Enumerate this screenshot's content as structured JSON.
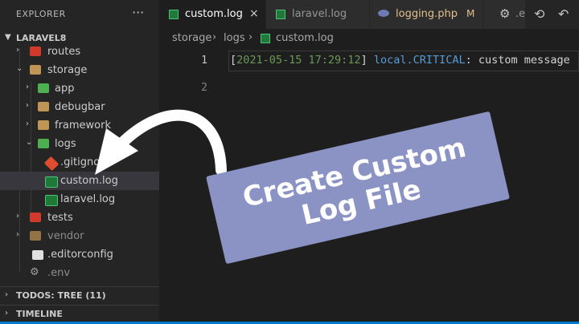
{
  "sidebar": {
    "title": "EXPLORER",
    "more": "···",
    "project": "LARAVEL8",
    "tree": [
      {
        "label": "routes",
        "icon": "folder-red-icon"
      },
      {
        "label": "storage",
        "icon": "folder-open-icon"
      },
      {
        "label": "app",
        "icon": "folder-green-icon"
      },
      {
        "label": "debugbar",
        "icon": "folder-icon"
      },
      {
        "label": "framework",
        "icon": "folder-icon"
      },
      {
        "label": "logs",
        "icon": "folder-open-green-icon"
      },
      {
        "label": ".gitignore",
        "icon": "git-icon"
      },
      {
        "label": "custom.log",
        "icon": "log-file-icon"
      },
      {
        "label": "laravel.log",
        "icon": "log-file-icon"
      },
      {
        "label": "tests",
        "icon": "folder-red-icon"
      },
      {
        "label": "vendor",
        "icon": "folder-icon"
      },
      {
        "label": ".editorconfig",
        "icon": "editorconfig-icon"
      },
      {
        "label": ".env",
        "icon": "gear-icon"
      }
    ],
    "todos": "TODOS: TREE (11)",
    "timeline": "TIMELINE"
  },
  "tabs": [
    {
      "label": "custom.log",
      "close": "×"
    },
    {
      "label": "laravel.log"
    },
    {
      "label": "logging.php",
      "modified": "M"
    },
    {
      "label": ".e"
    }
  ],
  "breadcrumb": [
    "storage",
    "logs",
    "custom.log"
  ],
  "editor": {
    "lines": [
      "1",
      "2"
    ],
    "line1": {
      "bracket_open": "[",
      "timestamp": "2021-05-15 17:29:12",
      "bracket_close": "]",
      "level": "local.CRITICAL",
      "rest": ": custom message"
    }
  },
  "overlay": {
    "line1": "Create Custom",
    "line2": "Log File"
  },
  "colors": {
    "accent": "#007acc",
    "banner": "#8a93c4",
    "timestamp": "#6a9955",
    "level": "#569cd6",
    "modified": "#e2c08d"
  }
}
